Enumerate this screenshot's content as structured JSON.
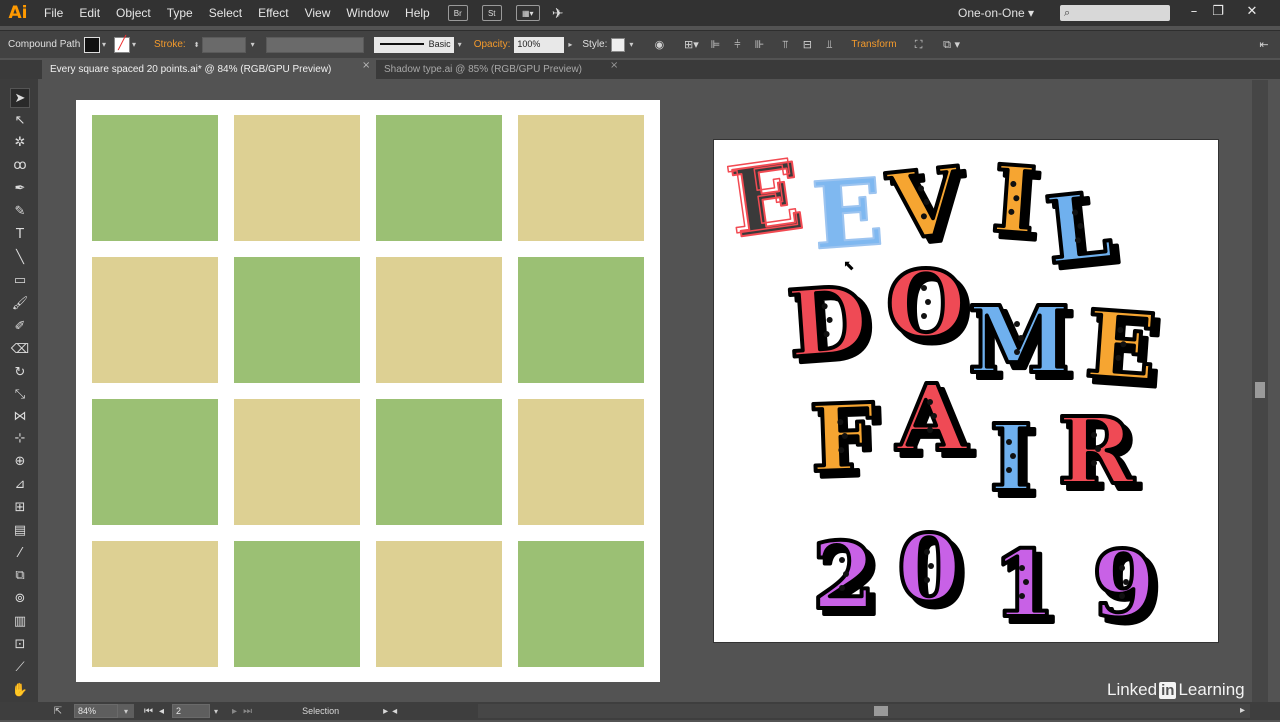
{
  "app": {
    "logo": "Ai",
    "accent": "#ff9a00"
  },
  "menus": [
    "File",
    "Edit",
    "Object",
    "Type",
    "Select",
    "Effect",
    "View",
    "Window",
    "Help"
  ],
  "menu_icons": {
    "bridge": "Br",
    "stock": "St",
    "arrange": "arrange-documents-icon",
    "gpu": "gpu-performance-icon"
  },
  "workspace": "One-on-One",
  "control_bar": {
    "selection_label": "Compound Path",
    "stroke_label": "Stroke:",
    "brush": "Basic",
    "opacity_label": "Opacity:",
    "opacity_value": "100%",
    "style_label": "Style:",
    "transform_label": "Transform"
  },
  "tabs": [
    {
      "label": "Every square spaced 20 points.ai* @ 84% (RGB/GPU Preview)",
      "active": true
    },
    {
      "label": "Shadow type.ai @ 85% (RGB/GPU Preview)",
      "active": false
    }
  ],
  "grid": {
    "green": "#9bc074",
    "tan": "#ddd093",
    "pattern": [
      "green",
      "tan",
      "green",
      "tan",
      "tan",
      "green",
      "tan",
      "green",
      "green",
      "tan",
      "green",
      "tan",
      "tan",
      "green",
      "tan",
      "green"
    ]
  },
  "artwork": {
    "lines": [
      [
        "E",
        "E",
        "V",
        "I",
        "L"
      ],
      [
        "D",
        "O",
        "M",
        "E"
      ],
      [
        "F",
        "A",
        "I",
        "R"
      ],
      [
        "2",
        "0",
        "1",
        "9"
      ]
    ],
    "colors": {
      "red": "#ef4a55",
      "blue": "#6fb0ee",
      "orange": "#f6a531",
      "purple": "#c861e6",
      "selected": "#f24a52",
      "selected_blue": "#7fb8f0"
    }
  },
  "status": {
    "zoom": "84%",
    "artboard": "2",
    "tool": "Selection"
  },
  "watermark": {
    "brand": "Linked",
    "in": "in",
    "product": "Learning"
  }
}
